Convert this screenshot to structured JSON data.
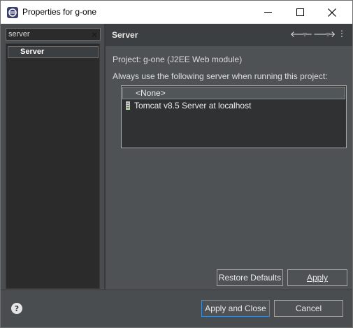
{
  "window": {
    "title": "Properties for g-one",
    "controls": {
      "minimize": "─",
      "maximize": "☐",
      "close": "✕"
    }
  },
  "filter": {
    "value": "server",
    "clear_icon": "clear-icon"
  },
  "tree": {
    "items": [
      {
        "label": "Server",
        "selected": true
      }
    ]
  },
  "page": {
    "title": "Server",
    "nav": {
      "back": "back-arrow-icon",
      "forward": "forward-arrow-icon",
      "menu": "view-menu-icon"
    },
    "project_label": "Project: g-one (J2EE Web module)",
    "instruction": "Always use the following server when running this project:",
    "servers": [
      {
        "label": "<None>",
        "selected": true
      },
      {
        "label": "Tomcat v8.5 Server at localhost",
        "icon": "server-icon",
        "selected": false
      }
    ],
    "buttons": {
      "restore_defaults": "Restore Defaults",
      "apply": "Apply"
    }
  },
  "footer": {
    "help_icon": "help-icon",
    "apply_close": "Apply and Close",
    "cancel": "Cancel"
  },
  "colors": {
    "background": "#4a4d4f",
    "tree_background": "#2b2b2b",
    "accent_border": "#3f8fd6"
  }
}
